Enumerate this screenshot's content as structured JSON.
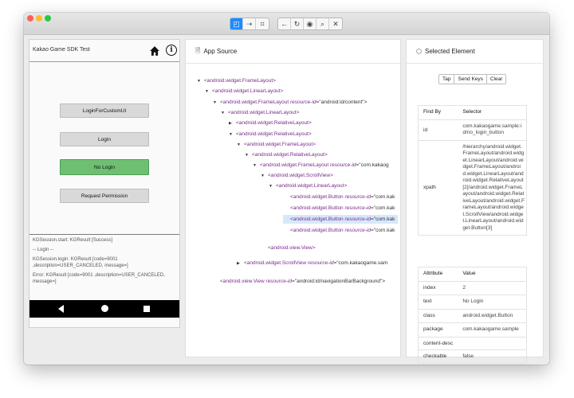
{
  "device": {
    "app_title": "Kakao Game SDK Test",
    "buttons": [
      "LoginForCustomUI",
      "Login",
      "No Login",
      "Request Permission"
    ],
    "log": [
      "KGSession.start: KGResult [Success]",
      "-- Login --",
      "KGSession.login: KGResult [code=9001 ,description=USER_CANCELED, message=]",
      "Error: KGResult [code=9001 ,description=USER_CANCELED, message=]"
    ]
  },
  "source": {
    "title": "App Source",
    "nodes": [
      {
        "arrow": "▼",
        "tag": "<android.widget.FrameLayout>"
      },
      {
        "arrow": "▼",
        "tag": "<android.widget.LinearLayout>"
      },
      {
        "arrow": "▼",
        "tag": "<android.widget.FrameLayout",
        "attr": "resource-id",
        "val": "=\"android:id/content\">"
      },
      {
        "arrow": "▼",
        "tag": "<android.widget.LinearLayout>"
      },
      {
        "arrow": "▶",
        "tag": "<android.widget.RelativeLayout>"
      },
      {
        "arrow": "▼",
        "tag": "<android.widget.RelativeLayout>"
      },
      {
        "arrow": "▼",
        "tag": "<android.widget.FrameLayout>"
      },
      {
        "arrow": "▼",
        "tag": "<android.widget.RelativeLayout>"
      },
      {
        "arrow": "▼",
        "tag": "<android.widget.FrameLayout",
        "attr": "resource-id",
        "val": "=\"com.kakaog"
      },
      {
        "arrow": "▼",
        "tag": "<android.widget.ScrollView>"
      },
      {
        "arrow": "▼",
        "tag": "<android.widget.LinearLayout>"
      },
      {
        "arrow": "",
        "tag": "<android.widget.Button",
        "attr": "resource-id",
        "val": "=\"com.kak"
      },
      {
        "arrow": "",
        "tag": "<android.widget.Button",
        "attr": "resource-id",
        "val": "=\"com.kak"
      },
      {
        "arrow": "",
        "tag": "<android.widget.Button",
        "attr": "resource-id",
        "val": "=\"com.kak"
      },
      {
        "arrow": "",
        "tag": "<android.widget.Button",
        "attr": "resource-id",
        "val": "=\"com.kak"
      },
      {
        "arrow": "",
        "tag": "<android.view.View>"
      },
      {
        "arrow": "▶",
        "tag": "<android.widget.ScrollView",
        "attr": "resource-id",
        "val": "=\"com.kakaogame.sam"
      },
      {
        "arrow": "",
        "tag": "<android.view.View",
        "attr": "resource-id",
        "val": "=\"android:id/navigationBarBackground\">"
      }
    ]
  },
  "selected": {
    "title": "Selected Element",
    "actions": [
      "Tap",
      "Send Keys",
      "Clear"
    ],
    "find_by": {
      "headers": [
        "Find By",
        "Selector"
      ],
      "rows": [
        [
          "id",
          "com.kakaogame.sample:id/no_login_button"
        ],
        [
          "xpath",
          "/hierarchy/android.widget.FrameLayout/android.widget.LinearLayout/android.widget.FrameLayout/android.widget.LinearLayout/android.widget.RelativeLayout[2]/android.widget.FrameLayout/android.widget.RelativeLayout/android.widget.FrameLayout/android.widget.ScrollView/android.widget.LinearLayout/android.widget.Button[3]"
        ]
      ]
    },
    "attributes": {
      "headers": [
        "Attribute",
        "Value"
      ],
      "rows": [
        [
          "index",
          "2"
        ],
        [
          "text",
          "No Login"
        ],
        [
          "class",
          "android.widget.Button"
        ],
        [
          "package",
          "com.kakaogame.sample"
        ],
        [
          "content-desc",
          ""
        ],
        [
          "checkable",
          "false"
        ]
      ]
    }
  },
  "colors": {
    "accent": "#1a8cff",
    "selected_button": "#6fbf73",
    "highlight": "#d6e8fb"
  }
}
